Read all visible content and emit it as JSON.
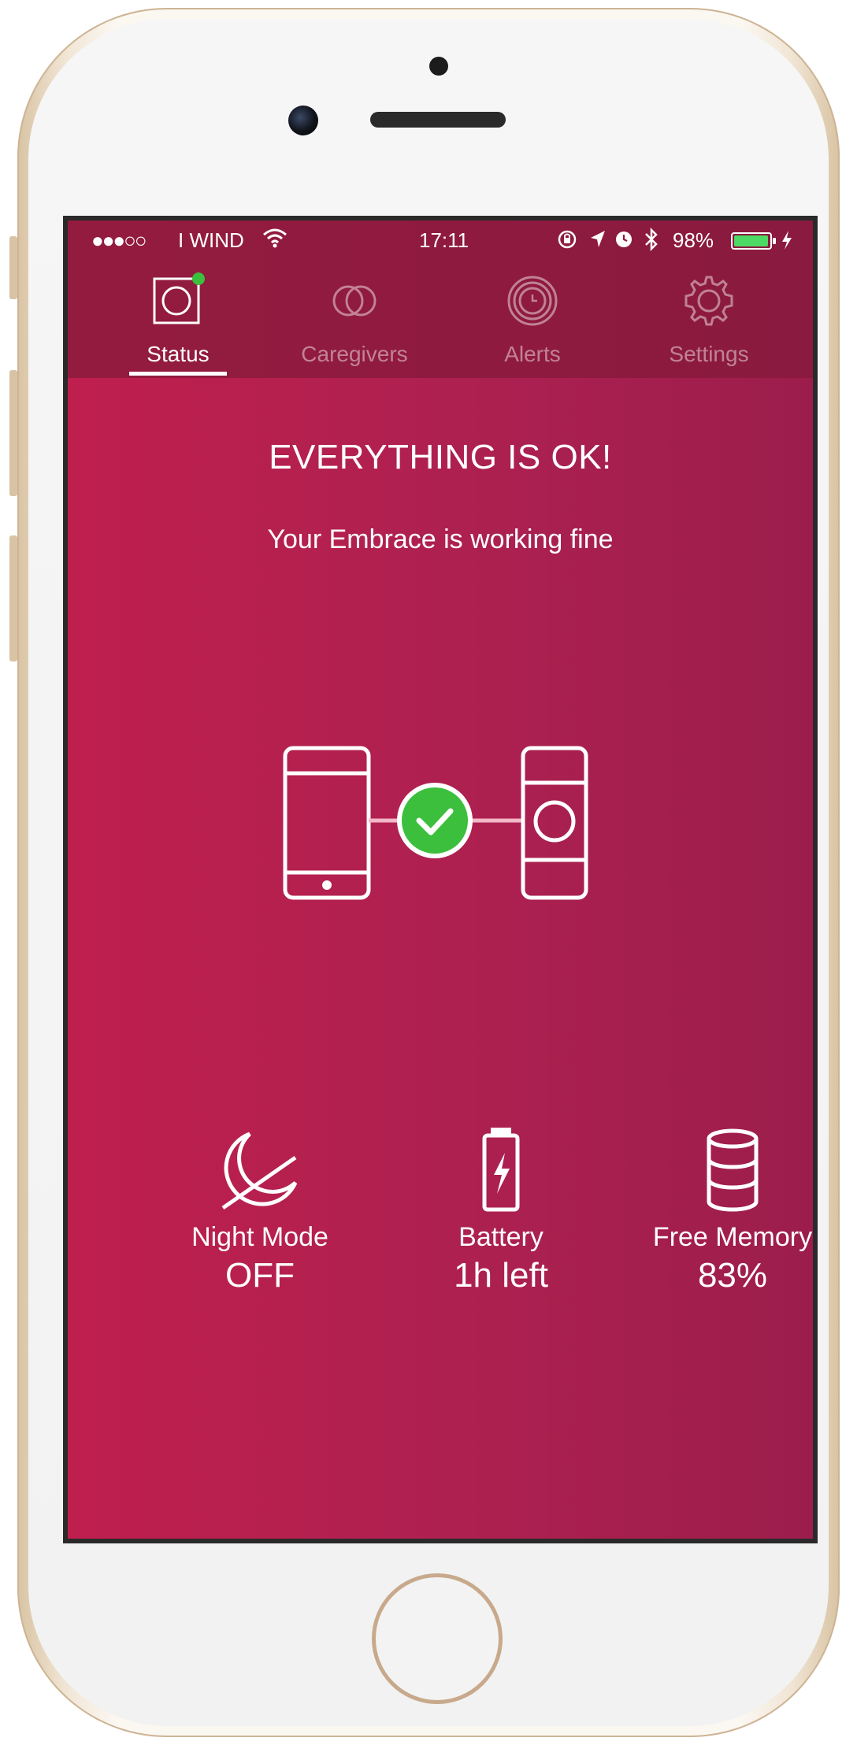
{
  "status_bar": {
    "carrier": "I WIND",
    "time": "17:11",
    "battery_percent": "98%",
    "battery_level": 0.98
  },
  "tabs": [
    {
      "label": "Status",
      "icon": "status-watch-icon",
      "active": true
    },
    {
      "label": "Caregivers",
      "icon": "caregivers-icon",
      "active": false
    },
    {
      "label": "Alerts",
      "icon": "alerts-icon",
      "active": false
    },
    {
      "label": "Settings",
      "icon": "gear-icon",
      "active": false
    }
  ],
  "main": {
    "title": "EVERYTHING IS OK!",
    "subtitle": "Your Embrace is working fine"
  },
  "stats": [
    {
      "label": "Night Mode",
      "value": "OFF",
      "icon": "moon-icon"
    },
    {
      "label": "Battery",
      "value": "1h left",
      "icon": "battery-bolt-icon"
    },
    {
      "label": "Free Memory",
      "value": "83%",
      "icon": "database-icon"
    }
  ],
  "colors": {
    "background": "#b01f4f",
    "header": "#8e1a3f",
    "accent_green": "#3cbf3c"
  }
}
